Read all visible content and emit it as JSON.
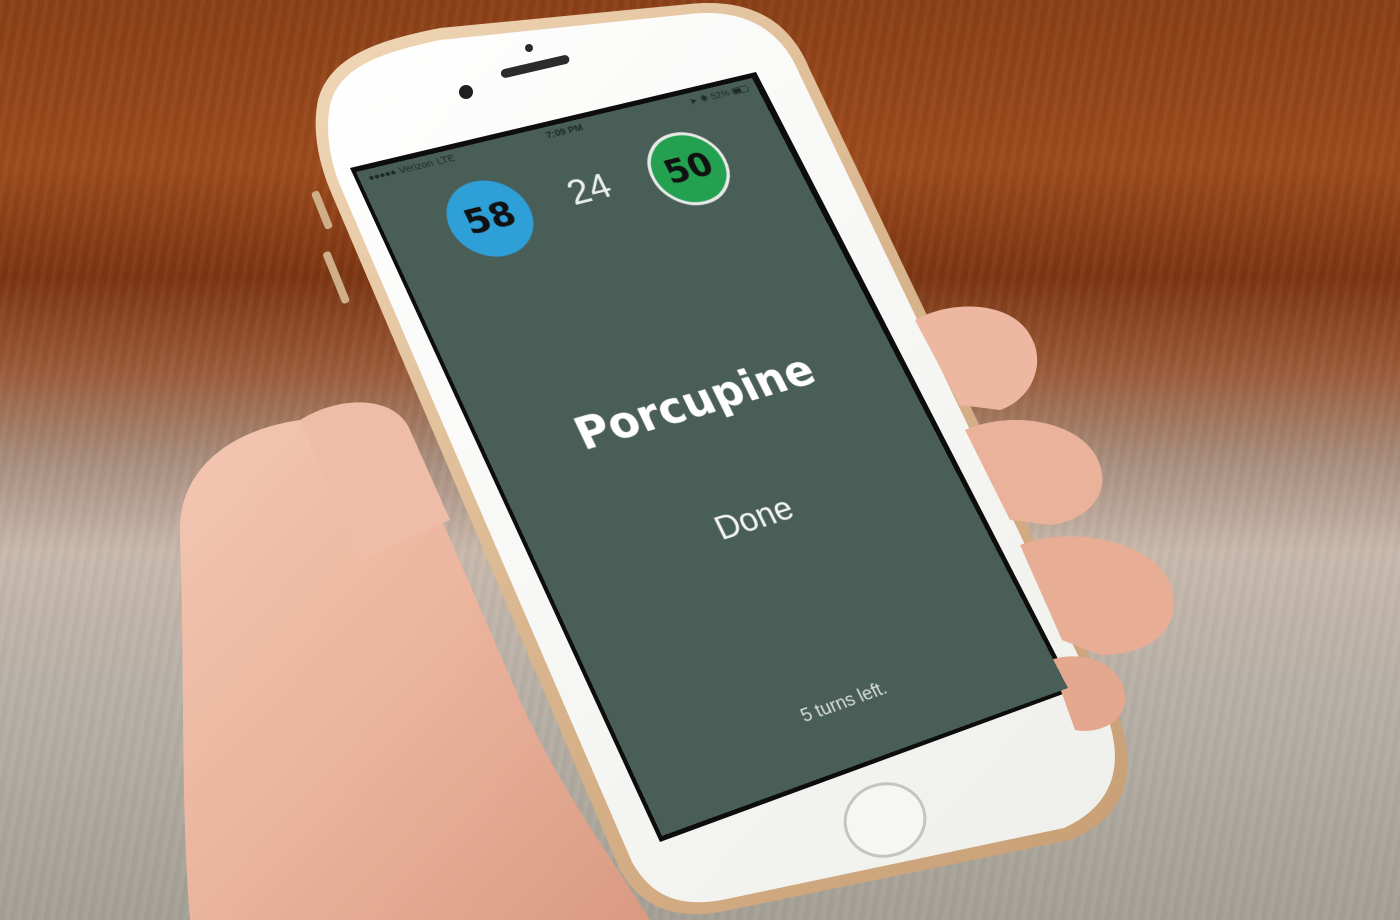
{
  "status_bar": {
    "carrier": "Verizon",
    "network": "LTE",
    "time": "7:09 PM",
    "battery": "52%",
    "battery_level": 0.52
  },
  "scores": {
    "left_team": "58",
    "right_team": "50",
    "timer": "24"
  },
  "card": {
    "word": "Porcupine",
    "done_label": "Done",
    "turns_left": "5 turns left."
  },
  "colors": {
    "screen_background": "#4a5e58",
    "left_team": "#2f9fd8",
    "right_team": "#23a150",
    "text": "#ffffff"
  }
}
